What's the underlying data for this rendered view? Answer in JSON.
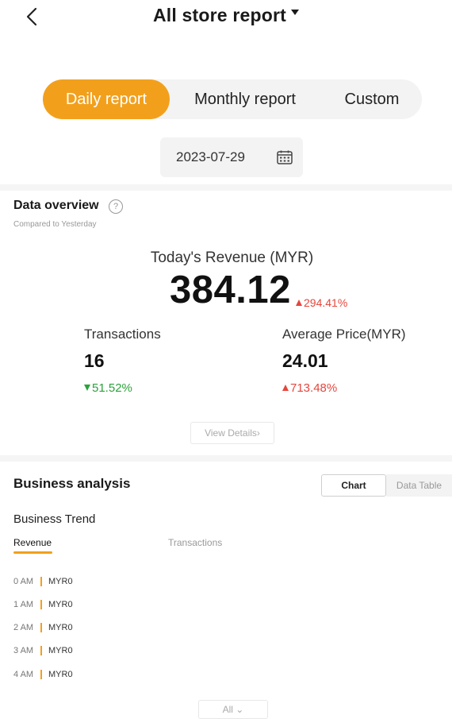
{
  "header": {
    "title": "All store report",
    "back_icon": "chevron-left-icon",
    "title_caret_icon": "caret-down-icon"
  },
  "period_tabs": [
    {
      "label": "Daily report",
      "active": true
    },
    {
      "label": "Monthly report",
      "active": false
    },
    {
      "label": "Custom",
      "active": false
    }
  ],
  "date_picker": {
    "value": "2023-07-29",
    "icon": "calendar-icon"
  },
  "overview": {
    "title": "Data overview",
    "help_icon_glyph": "?",
    "subtitle": "Compared to Yesterday",
    "revenue": {
      "label": "Today's Revenue (MYR)",
      "value": "384.12",
      "change": "294.41%",
      "direction": "up"
    },
    "transactions": {
      "label": "Transactions",
      "value": "16",
      "change": "51.52%",
      "direction": "down"
    },
    "average_price": {
      "label": "Average Price(MYR)",
      "value": "24.01",
      "change": "713.48%",
      "direction": "up"
    },
    "view_details": "View Details›"
  },
  "business_analysis": {
    "title": "Business analysis",
    "view_toggle": {
      "chart": "Chart",
      "data_table": "Data Table",
      "active": "chart"
    },
    "trend_title": "Business Trend",
    "tabs": {
      "revenue": "Revenue",
      "transactions": "Transactions",
      "active": "revenue"
    },
    "rows": [
      {
        "time": "0 AM",
        "value": "MYR0"
      },
      {
        "time": "1 AM",
        "value": "MYR0"
      },
      {
        "time": "2 AM",
        "value": "MYR0"
      },
      {
        "time": "3 AM",
        "value": "MYR0"
      },
      {
        "time": "4 AM",
        "value": "MYR0"
      }
    ],
    "filter": "All ⌄"
  },
  "colors": {
    "accent": "#f2a01c",
    "up": "#e5463d",
    "down": "#2aa33b"
  }
}
